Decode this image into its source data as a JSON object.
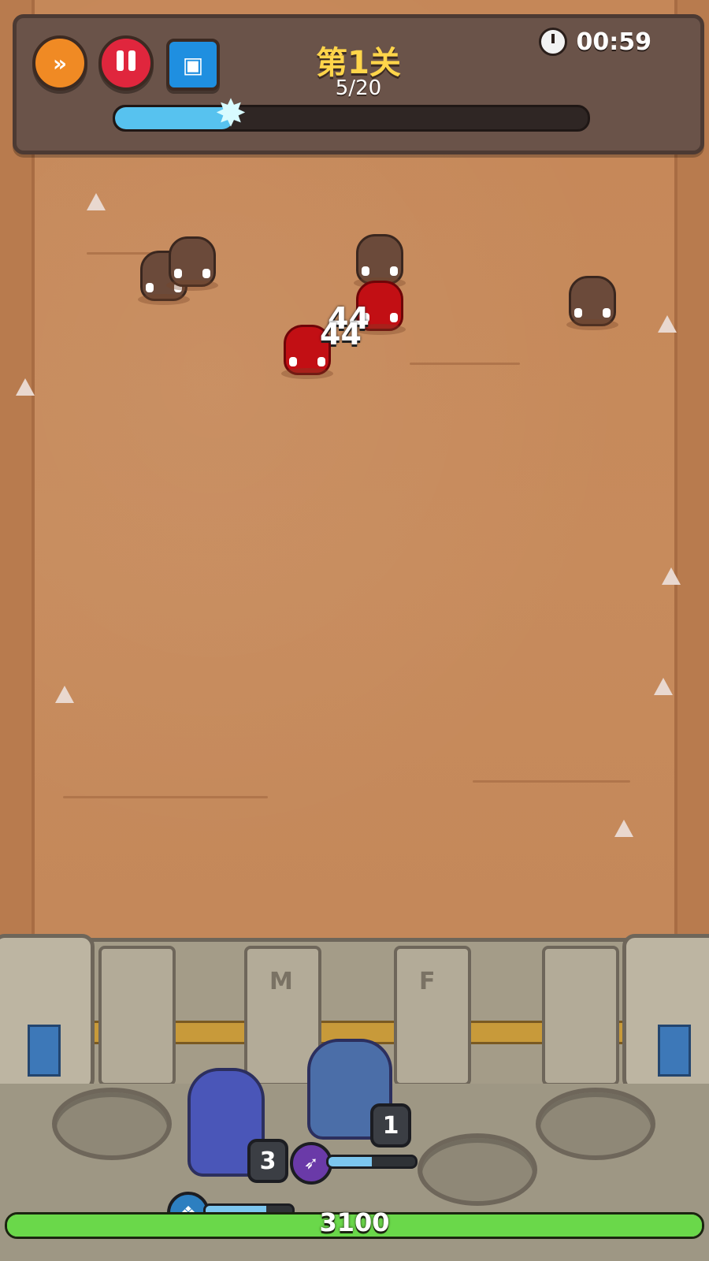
{
  "hud": {
    "level_title": "第1关",
    "wave_progress_text": "5/20",
    "wave_current": 5,
    "wave_total": 20,
    "timer": "00:59",
    "buttons": {
      "speed_icon": "fast-forward-icon",
      "pause_icon": "pause-icon",
      "cards_icon": "hero-cards-icon"
    }
  },
  "enemies": [
    {
      "type": "boar",
      "state": "normal"
    },
    {
      "type": "boar",
      "state": "normal"
    },
    {
      "type": "boar",
      "state": "normal"
    },
    {
      "type": "boar",
      "state": "normal"
    },
    {
      "type": "boar",
      "state": "hit"
    },
    {
      "type": "boar",
      "state": "hit"
    }
  ],
  "damage_numbers": [
    "44",
    "44"
  ],
  "wall_runes": [
    "M",
    "F"
  ],
  "heroes": [
    {
      "name_icon": "ice-mage-hero",
      "level": "3",
      "skill_icon": "ice-crystal-icon",
      "mana": 0.7
    },
    {
      "name_icon": "dark-archer-hero",
      "level": "1",
      "skill_icon": "arrow-volley-icon",
      "mana": 0.5
    }
  ],
  "base": {
    "hp_text": "3100",
    "hp_fraction": 1.0
  },
  "colors": {
    "progress": "#57c2ef",
    "hp": "#6ad84a",
    "title": "#ffd54a",
    "hit_enemy": "#c20f14"
  }
}
